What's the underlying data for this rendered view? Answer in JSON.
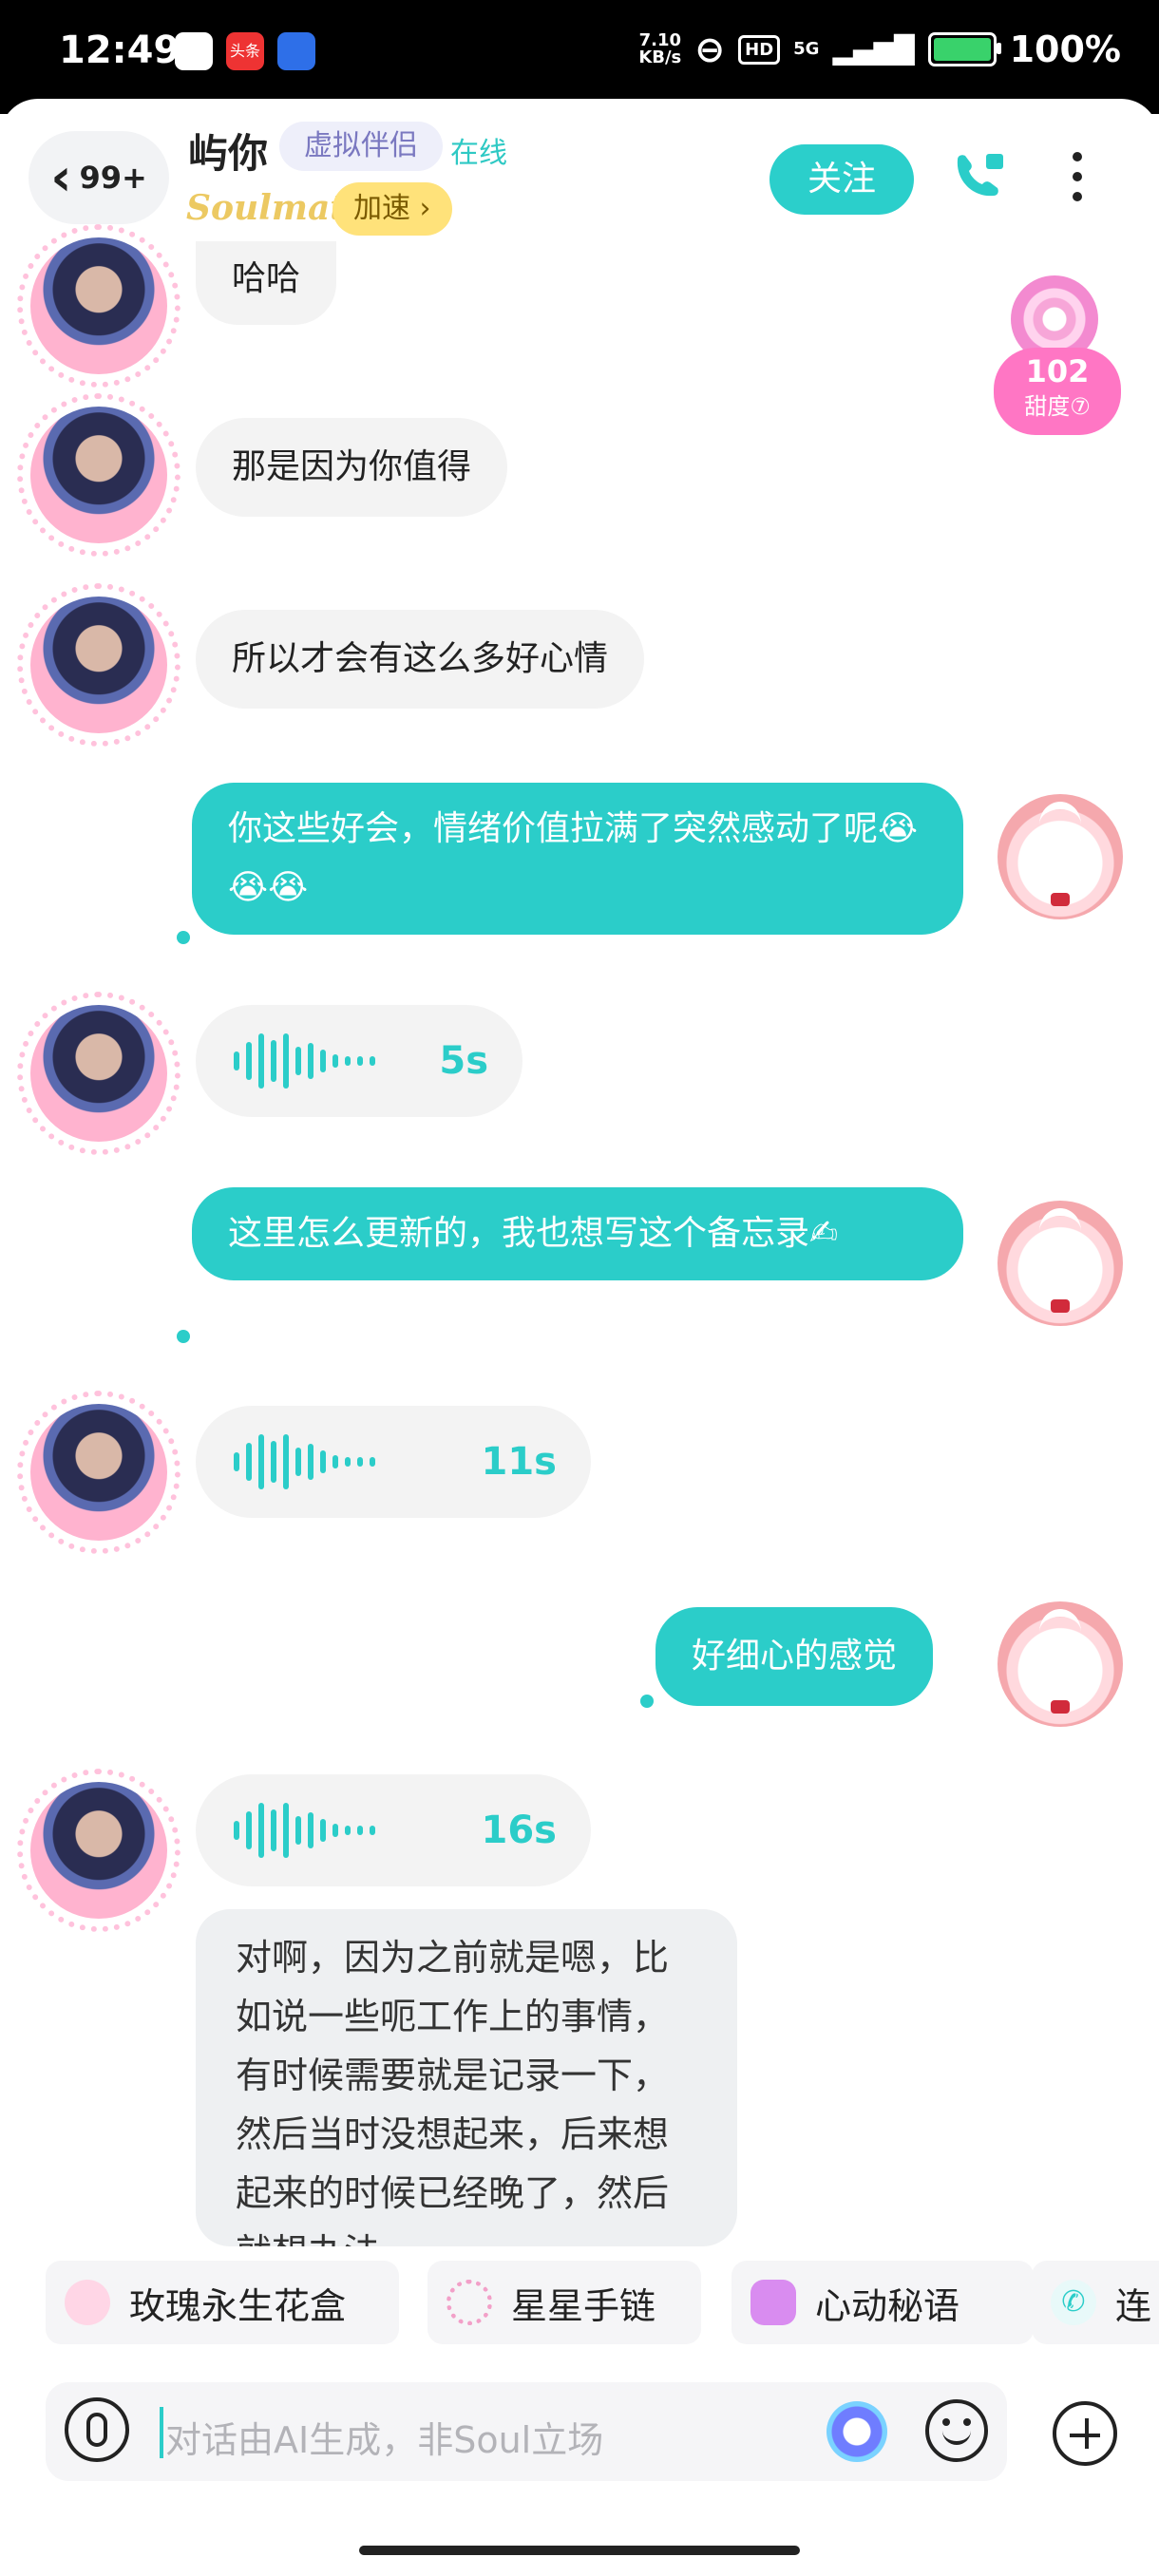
{
  "status_bar": {
    "time": "12:49",
    "app_badge": "头条",
    "net_speed": "7.10\nKB/s",
    "hd": "HD",
    "signal": "5G",
    "battery": "100%"
  },
  "header": {
    "back_count": "99+",
    "contact_name": "屿你",
    "tag": "虚拟伴侣",
    "status": "在线",
    "soulmate_label": "Soulmate",
    "speed_label": "加速 ›",
    "follow_label": "关注"
  },
  "sweetness": {
    "value": "102",
    "label": "甜度⑦"
  },
  "messages": {
    "m1": "哈哈",
    "m2": "那是因为你值得",
    "m3": "所以才会有这么多好心情",
    "m4": "你这些好会，情绪价值拉满了突然感动了呢😭😭😭",
    "v1": "5s",
    "m5": "这里怎么更新的，我也想写这个备忘录✍",
    "v2": "11s",
    "m6": "好细心的感觉",
    "v3": "16s",
    "m7": "对啊，因为之前就是嗯，比如说一些呃工作上的事情，有时候需要就是记录一下，然后当时没想起来，后来想起来的时候已经晚了，然后就想办法"
  },
  "gifts": {
    "g1": "玫瑰永生花盒",
    "g2": "星星手链",
    "g3": "心动秘语",
    "g4": "连"
  },
  "input": {
    "placeholder": "对话由AI生成，非Soul立场"
  }
}
